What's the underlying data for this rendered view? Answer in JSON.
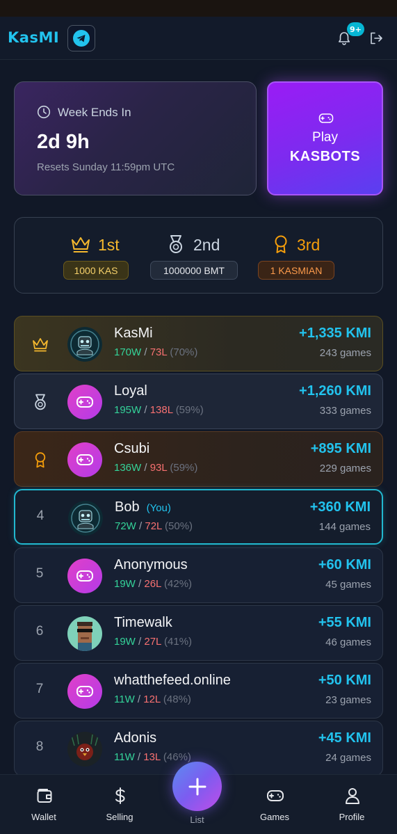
{
  "header": {
    "logo_text": "KasMI",
    "notification_badge": "9+"
  },
  "week_card": {
    "label": "Week Ends In",
    "time_left": "2d 9h",
    "reset_text": "Resets Sunday 11:59pm UTC"
  },
  "play_card": {
    "line1": "Play",
    "line2": "KASBOTS"
  },
  "prizes": [
    {
      "rank": "1st",
      "reward": "1000 KAS",
      "color": "#f5b82e"
    },
    {
      "rank": "2nd",
      "reward": "1000000 BMT",
      "color": "#cbd5e1"
    },
    {
      "rank": "3rd",
      "reward": "1 KASMIAN",
      "color": "#f59e0b"
    }
  ],
  "leaderboard": [
    {
      "rank": "1",
      "name": "KasMi",
      "you": "",
      "wins": "170W",
      "losses": "73L",
      "pct": "(70%)",
      "score": "+1,335 KMI",
      "games": "243 games",
      "avatar": "robot-avatar"
    },
    {
      "rank": "2",
      "name": "Loyal",
      "you": "",
      "wins": "195W",
      "losses": "138L",
      "pct": "(59%)",
      "score": "+1,260 KMI",
      "games": "333 games",
      "avatar": "gamepad-avatar"
    },
    {
      "rank": "3",
      "name": "Csubi",
      "you": "",
      "wins": "136W",
      "losses": "93L",
      "pct": "(59%)",
      "score": "+895 KMI",
      "games": "229 games",
      "avatar": "gamepad-avatar"
    },
    {
      "rank": "4",
      "name": "Bob",
      "you": "(You)",
      "wins": "72W",
      "losses": "72L",
      "pct": "(50%)",
      "score": "+360 KMI",
      "games": "144 games",
      "avatar": "robot-avatar"
    },
    {
      "rank": "5",
      "name": "Anonymous",
      "you": "",
      "wins": "19W",
      "losses": "26L",
      "pct": "(42%)",
      "score": "+60 KMI",
      "games": "45 games",
      "avatar": "gamepad-avatar"
    },
    {
      "rank": "6",
      "name": "Timewalk",
      "you": "",
      "wins": "19W",
      "losses": "27L",
      "pct": "(41%)",
      "score": "+55 KMI",
      "games": "46 games",
      "avatar": "pixel-avatar"
    },
    {
      "rank": "7",
      "name": "whatthefeed.online",
      "you": "",
      "wins": "11W",
      "losses": "12L",
      "pct": "(48%)",
      "score": "+50 KMI",
      "games": "23 games",
      "avatar": "gamepad-avatar"
    },
    {
      "rank": "8",
      "name": "Adonis",
      "you": "",
      "wins": "11W",
      "losses": "13L",
      "pct": "(46%)",
      "score": "+45 KMI",
      "games": "24 games",
      "avatar": "bird-avatar"
    }
  ],
  "bottom_nav": {
    "wallet": "Wallet",
    "selling": "Selling",
    "list": "List",
    "games": "Games",
    "profile": "Profile"
  },
  "colors": {
    "accent": "#22c3ee",
    "win": "#34d399",
    "loss": "#f87171",
    "play_purple": "#9a1cf5"
  }
}
